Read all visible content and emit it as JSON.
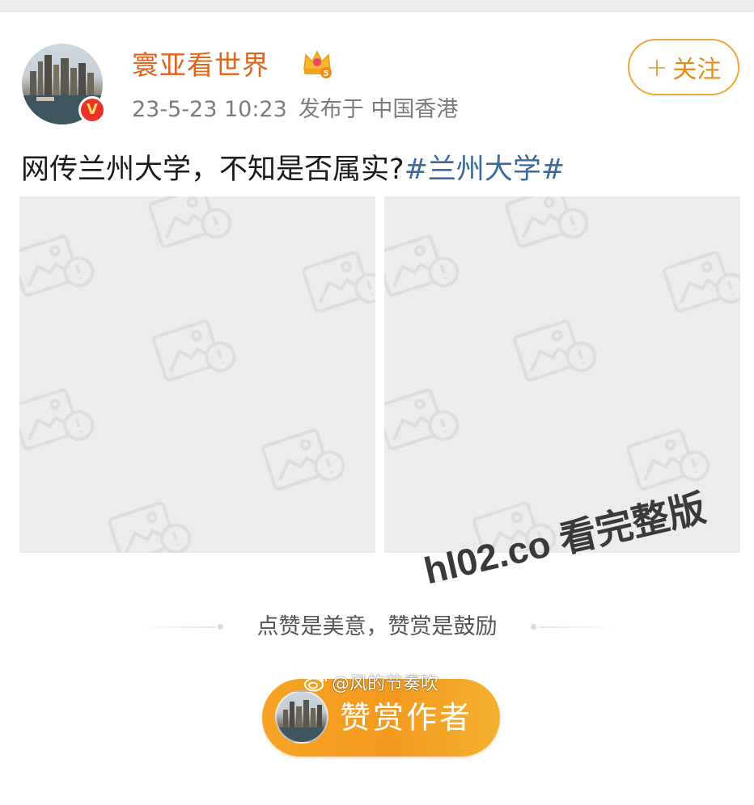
{
  "post": {
    "username": "寰亚看世界",
    "level_badge": "5",
    "verified_mark": "V",
    "timestamp": "23-5-23 10:23",
    "location": "发布于 中国香港",
    "text": "网传兰州大学，不知是否属实?",
    "hashtag": "#兰州大学#"
  },
  "follow": {
    "plus": "+",
    "label": "关注"
  },
  "watermark": {
    "overlay": "hl02.co 看完整版",
    "weibo": "@风的节奏吹"
  },
  "reward": {
    "slogan": "点赞是美意，赞赏是鼓励",
    "button_label": "赞赏作者"
  },
  "colors": {
    "username": "#e2631b",
    "hashtag": "#3a6aa0",
    "follow_border": "#f0a63a",
    "reward_button": "#f7a324",
    "verified_badge": "#e9332a"
  },
  "icons": {
    "crown": "crown-level-icon",
    "verified": "verified-v-icon",
    "image_placeholder": "broken-image-icon",
    "weibo": "weibo-logo-icon"
  }
}
